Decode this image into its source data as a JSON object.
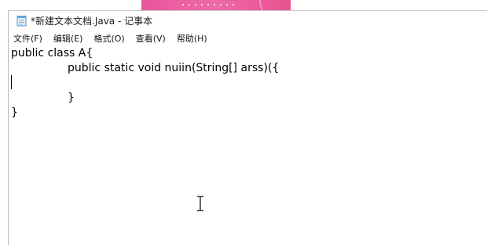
{
  "window": {
    "title": "*新建文本文档.Java - 记事本",
    "app_icon": "notepad-icon"
  },
  "menu": {
    "file": "文件(F)",
    "edit": "编辑(E)",
    "format": "格式(O)",
    "view": "查看(V)",
    "help": "帮助(H)"
  },
  "editor": {
    "lines": [
      "public class A{",
      "\t\tpublic static void nuiin(String[] arss)({",
      "",
      "\t\t}",
      "}"
    ]
  },
  "colors": {
    "desktop_accent": "#ee6aa8"
  }
}
